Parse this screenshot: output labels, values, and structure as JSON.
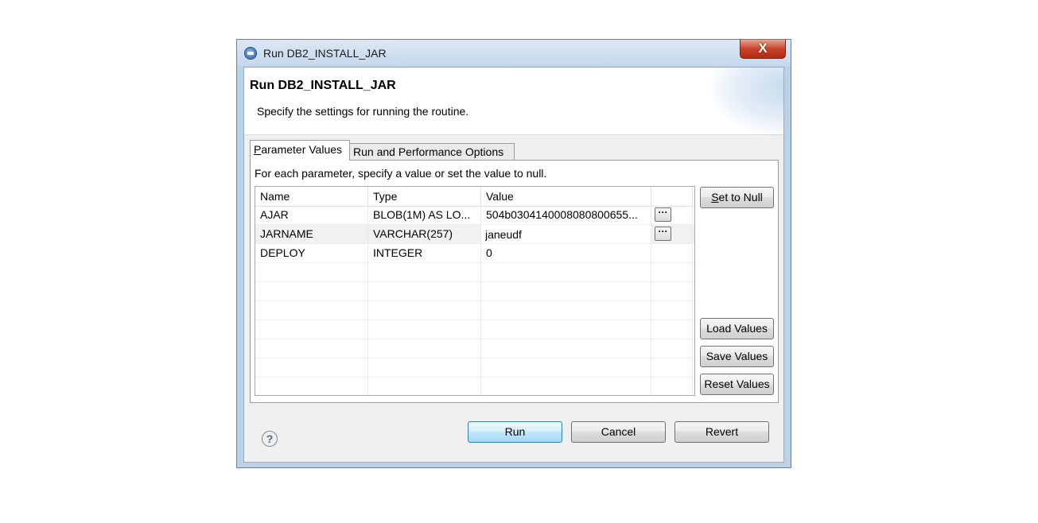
{
  "window": {
    "title": "Run DB2_INSTALL_JAR",
    "close_glyph": "X"
  },
  "header": {
    "title": "Run DB2_INSTALL_JAR",
    "description": "Specify the settings for running the routine."
  },
  "tabs": [
    {
      "label_underlined": "P",
      "label_rest": "arameter Values",
      "active": true
    },
    {
      "label": "Run and Performance Options",
      "active": false
    }
  ],
  "panel": {
    "instructions": "For each parameter, specify a value or set the value to null.",
    "columns": [
      "Name",
      "Type",
      "Value"
    ],
    "rows": [
      {
        "name": "AJAR",
        "type": "BLOB(1M) AS LO...",
        "value": "504b0304140008080800655...",
        "has_browse": true
      },
      {
        "name": "JARNAME",
        "type": "VARCHAR(257)",
        "value": "janeudf",
        "has_browse": true,
        "editing": true
      },
      {
        "name": "DEPLOY",
        "type": "INTEGER",
        "value": "0",
        "has_browse": false
      }
    ],
    "browse_glyph": "···"
  },
  "side_buttons": {
    "set_to_null_underlined": "S",
    "set_to_null_rest": "et to Null",
    "load_values": "Load Values",
    "save_values": "Save Values",
    "reset_values": "Reset Values"
  },
  "footer": {
    "help_glyph": "?",
    "run": "Run",
    "cancel": "Cancel",
    "revert": "Revert"
  },
  "colors": {
    "frame": "#bcd0e6",
    "close_button": "#c7432a",
    "default_button": "#bee6fd"
  }
}
